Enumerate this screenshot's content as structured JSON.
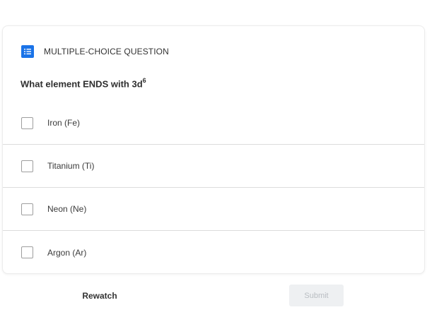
{
  "question": {
    "type_label": "MULTIPLE-CHOICE QUESTION",
    "type_icon": "list-icon",
    "text_main": "What element ENDS with 3d",
    "text_superscript": "6"
  },
  "options": [
    {
      "label": "Iron (Fe)",
      "checked": false
    },
    {
      "label": "Titanium (Ti)",
      "checked": false
    },
    {
      "label": "Neon (Ne)",
      "checked": false
    },
    {
      "label": "Argon (Ar)",
      "checked": false
    }
  ],
  "actions": {
    "rewatch_label": "Rewatch",
    "submit_label": "Submit"
  },
  "colors": {
    "accent": "#1a73e8",
    "submit_bg": "#eef0f2",
    "submit_text": "#b9bdc2",
    "divider": "#dcdcdc"
  }
}
